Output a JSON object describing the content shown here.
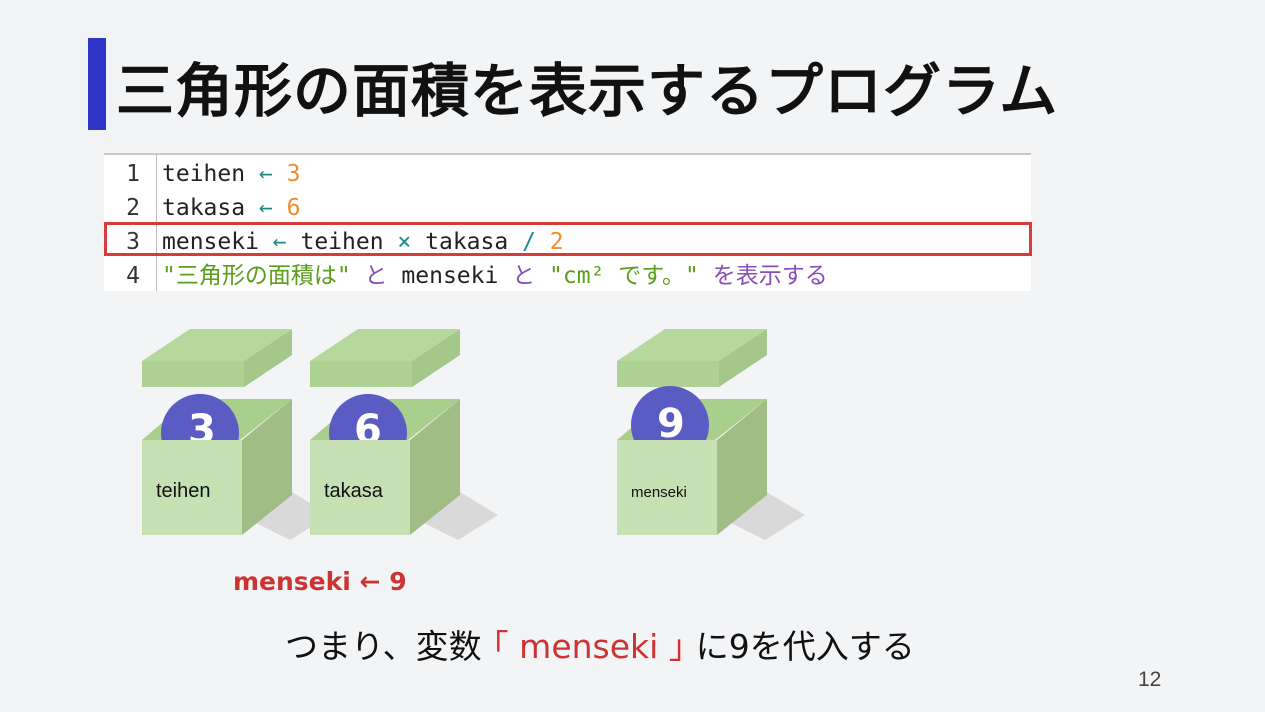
{
  "title": "三角形の面積を表示するプログラム",
  "code_lines": [
    {
      "num": "1",
      "parts": [
        {
          "t": "teihen",
          "c": "v"
        },
        {
          "t": " ← ",
          "c": "op"
        },
        {
          "t": "3",
          "c": "num"
        }
      ]
    },
    {
      "num": "2",
      "parts": [
        {
          "t": "takasa",
          "c": "v"
        },
        {
          "t": " ← ",
          "c": "op"
        },
        {
          "t": "6",
          "c": "num"
        }
      ]
    },
    {
      "num": "3",
      "parts": [
        {
          "t": "menseki",
          "c": "v"
        },
        {
          "t": " ← ",
          "c": "op"
        },
        {
          "t": "teihen",
          "c": "v"
        },
        {
          "t": " × ",
          "c": "op"
        },
        {
          "t": "takasa",
          "c": "v"
        },
        {
          "t": " / ",
          "c": "op"
        },
        {
          "t": "2",
          "c": "num"
        }
      ]
    },
    {
      "num": "4",
      "parts": [
        {
          "t": "\"三角形の面積は\"",
          "c": "str"
        },
        {
          "t": " と ",
          "c": "kw"
        },
        {
          "t": "menseki",
          "c": "v"
        },
        {
          "t": " と ",
          "c": "kw"
        },
        {
          "t": "\"cm² です。\"",
          "c": "str"
        },
        {
          "t": " を表示する",
          "c": "kw"
        }
      ]
    }
  ],
  "boxes": [
    {
      "label": "teihen",
      "value": "3"
    },
    {
      "label": "takasa",
      "value": "6"
    },
    {
      "label": "menseki",
      "value": "9"
    }
  ],
  "caption": "menseki ← 9",
  "sentence": {
    "before": "つまり、変数 ",
    "bracket_open": "｢ ",
    "var": "menseki",
    "bracket_close": " ｣",
    "after": " に9を代入する"
  },
  "page_number": "12",
  "colors": {
    "accent_bar": "#2f35c7",
    "highlight": "#d93a3a",
    "box": "#c5e0b3",
    "ball": "#5b5bc4"
  }
}
